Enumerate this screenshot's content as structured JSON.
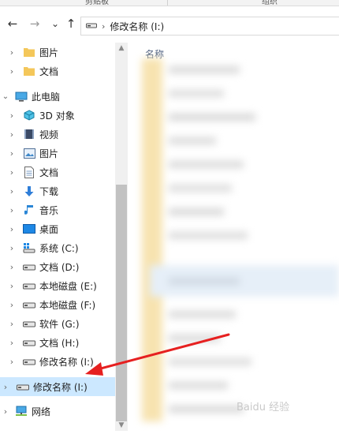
{
  "ribbon": {
    "labels": [
      "剪贴板",
      "组织"
    ]
  },
  "nav": {
    "back": "←",
    "forward": "→",
    "recent": "⌄",
    "up": "↑"
  },
  "address": {
    "path": "修改名称 (I:)"
  },
  "content": {
    "column_name": "名称"
  },
  "tree": {
    "quick_items": [
      "图片",
      "文档"
    ],
    "this_pc": "此电脑",
    "pc_items": [
      "3D 对象",
      "视频",
      "图片",
      "文档",
      "下载",
      "音乐",
      "桌面",
      "系统 (C:)",
      "文档 (D:)",
      "本地磁盘 (E:)",
      "本地磁盘 (F:)",
      "软件 (G:)",
      "文档 (H:)",
      "修改名称 (I:)"
    ],
    "selected_drive": "修改名称 (I:)",
    "network": "网络"
  },
  "watermark": "Baidu 经验",
  "colors": {
    "selected": "#cce8ff",
    "arrow": "#e62020",
    "folder": "#f4c75a"
  }
}
